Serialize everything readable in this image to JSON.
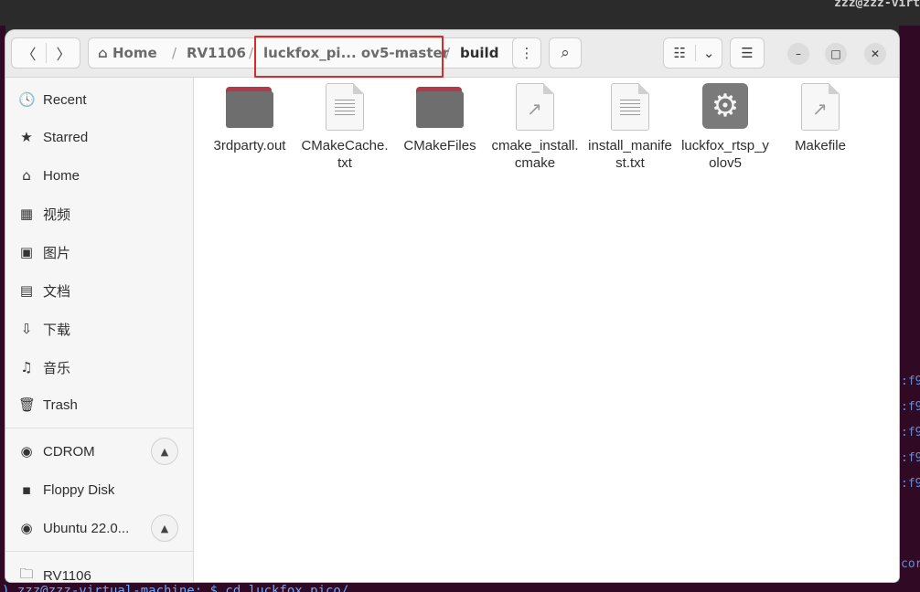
{
  "desktop": {
    "user_host": "zzz@zzz-virt",
    "terminal_right_lines": [
      ":f9",
      ":f9",
      ":f9",
      ":f9",
      ":f9",
      "cor"
    ],
    "terminal_bottom_cmd": ") zzz@zzz-virtual-machine: $ cd luckfox_pico/"
  },
  "toolbar": {
    "back": "〈",
    "forward": "〉",
    "more": "⋮",
    "search": "⌕",
    "view_list": "☷",
    "view_toggle": "⌄",
    "menu": "☰",
    "minimize": "–",
    "maximize": "□",
    "close": "✕"
  },
  "path": {
    "home": "Home",
    "sep": "/",
    "items": [
      "RV1106",
      "luckfox_pi... ov5-master",
      "build"
    ]
  },
  "sidebar": {
    "items": [
      {
        "icon": "recent-icon",
        "glyph": "🕓",
        "label": "Recent"
      },
      {
        "icon": "star-icon",
        "glyph": "★",
        "label": "Starred"
      },
      {
        "icon": "home-icon",
        "glyph": "⌂",
        "label": "Home"
      },
      {
        "icon": "video-icon",
        "glyph": "▦",
        "label": "视频"
      },
      {
        "icon": "picture-icon",
        "glyph": "▣",
        "label": "图片"
      },
      {
        "icon": "document-icon",
        "glyph": "▤",
        "label": "文档"
      },
      {
        "icon": "download-icon",
        "glyph": "⇩",
        "label": "下载"
      },
      {
        "icon": "music-icon",
        "glyph": "♫",
        "label": "音乐"
      },
      {
        "icon": "trash-icon",
        "glyph": "🗑",
        "label": "Trash"
      }
    ],
    "devices": [
      {
        "icon": "disc-icon",
        "glyph": "◉",
        "label": "CDROM",
        "eject": "▲"
      },
      {
        "icon": "floppy-icon",
        "glyph": "▪",
        "label": "Floppy Disk"
      },
      {
        "icon": "disc-icon",
        "glyph": "◉",
        "label": "Ubuntu 22.0...",
        "eject": "▲"
      }
    ],
    "bookmark": {
      "icon": "folder-icon",
      "glyph": "🗀",
      "label": "RV1106"
    }
  },
  "files": [
    {
      "name": "3rdparty.out",
      "type": "folder"
    },
    {
      "name": "CMakeCache.txt",
      "type": "text"
    },
    {
      "name": "CMakeFiles",
      "type": "folder"
    },
    {
      "name": "cmake_install.cmake",
      "type": "script"
    },
    {
      "name": "install_manifest.txt",
      "type": "text"
    },
    {
      "name": "luckfox_rtsp_yolov5",
      "type": "executable"
    },
    {
      "name": "Makefile",
      "type": "script"
    }
  ],
  "colors": {
    "folder_tab": "#b03a48",
    "folder_body": "#6e6e6e",
    "highlight_box": "#d62b2b",
    "terminal_bg": "#300a24"
  }
}
